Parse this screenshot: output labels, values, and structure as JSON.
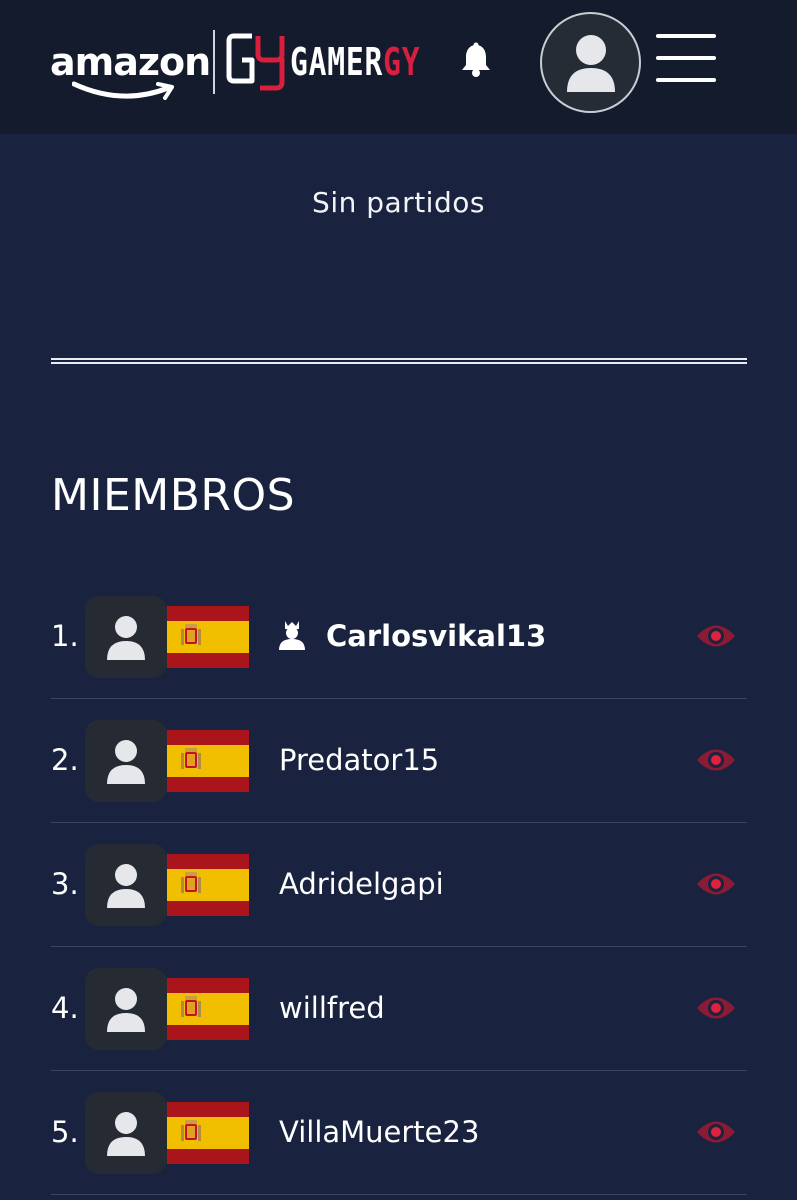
{
  "header": {
    "amazon_logo_text": "amazon",
    "gamergy_logo_white": "GAMER",
    "gamergy_logo_red": "GY"
  },
  "matches": {
    "empty_text": "Sin partidos"
  },
  "members_section": {
    "title": "MIEMBROS",
    "members": [
      {
        "rank": "1.",
        "name": "Carlosvikal13",
        "is_owner": true
      },
      {
        "rank": "2.",
        "name": "Predator15",
        "is_owner": false
      },
      {
        "rank": "3.",
        "name": "Adridelgapi",
        "is_owner": false
      },
      {
        "rank": "4.",
        "name": "willfred",
        "is_owner": false
      },
      {
        "rank": "5.",
        "name": "VillaMuerte23",
        "is_owner": false
      }
    ]
  },
  "colors": {
    "page_background": "#19233f",
    "header_background": "#141b2c",
    "brand_red": "#d81f3e",
    "flag_red": "#aa151b",
    "flag_yellow": "#f1bf00"
  }
}
